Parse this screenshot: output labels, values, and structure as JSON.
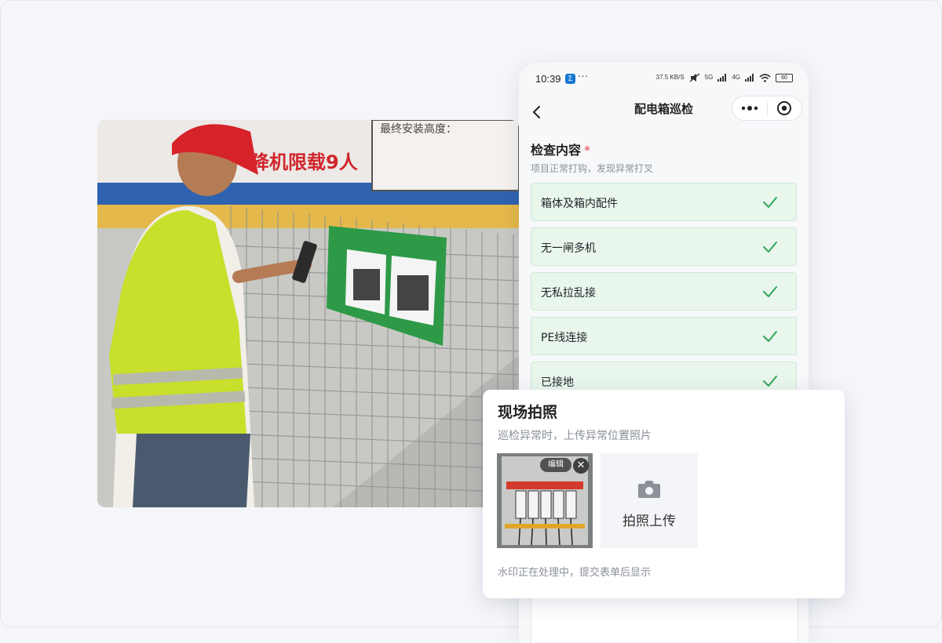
{
  "status_bar": {
    "time": "10:39",
    "app_badge": "Σ",
    "dots": "···",
    "speed": "37.5 KB/S",
    "network1": "5G",
    "network2": "4G",
    "battery": "60"
  },
  "nav": {
    "title": "配电箱巡检",
    "back_icon": "chevron-left-icon",
    "more_icon": "more-dots-icon",
    "close_icon": "target-icon"
  },
  "inspection": {
    "title": "检查内容",
    "required_mark": "*",
    "hint": "项目正常打钩，发现异常打叉",
    "items": [
      {
        "label": "箱体及箱内配件",
        "checked": true
      },
      {
        "label": "无一闸多机",
        "checked": true
      },
      {
        "label": "无私拉乱接",
        "checked": true
      },
      {
        "label": "PE线连接",
        "checked": true
      },
      {
        "label": "已接地",
        "checked": true
      }
    ],
    "check_color": "#2ea65a"
  },
  "photo_card": {
    "title": "现场拍照",
    "hint": "巡检异常时，上传异常位置照片",
    "thumb_edit": "编辑",
    "thumb_close": "✕",
    "upload_label": "拍照上传",
    "note": "水印正在处理中，提交表单后显示"
  },
  "scene_photo": {
    "sign_text": "降机限载9人",
    "sign_text2": "最终安装高度："
  },
  "colors": {
    "background": "#f5f6fa",
    "item_bg": "#e9f6ec",
    "item_border": "#cfe9d6",
    "required": "#e5484d"
  }
}
